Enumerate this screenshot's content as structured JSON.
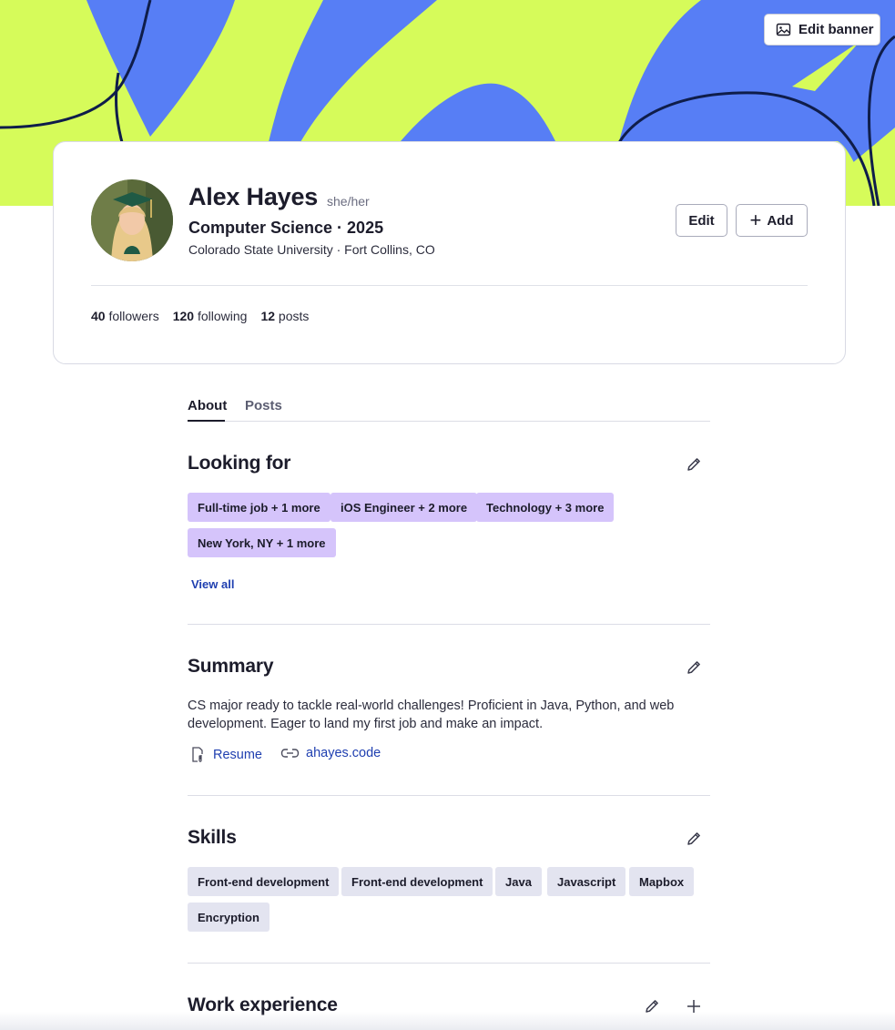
{
  "banner": {
    "edit_label": "Edit banner",
    "colors": {
      "lime": "#d6fb5a",
      "blue": "#577ef5",
      "navy": "#0f1d4a"
    }
  },
  "profile": {
    "name": "Alex Hayes",
    "pronouns": "she/her",
    "headline": "Computer Science · 2025",
    "location": "Colorado State University · Fort Collins, CO",
    "edit_label": "Edit",
    "add_label": "Add",
    "stats": [
      {
        "count": "40",
        "label": "followers"
      },
      {
        "count": "120",
        "label": "following"
      },
      {
        "count": "12",
        "label": "posts"
      }
    ]
  },
  "tabs": [
    {
      "label": "About",
      "active": true
    },
    {
      "label": "Posts",
      "active": false
    }
  ],
  "looking_for": {
    "title": "Looking for",
    "chips": [
      "Full-time job + 1 more",
      "iOS Engineer + 2 more",
      "Technology + 3 more",
      "New York, NY + 1 more"
    ],
    "view_all": "View all"
  },
  "summary": {
    "title": "Summary",
    "text": "CS major ready to tackle real-world challenges! Proficient in Java, Python, and web development. Eager to land my first job and make an impact.",
    "links": [
      {
        "label": "Resume",
        "icon": "paperclip-document-icon"
      },
      {
        "label": "ahayes.code",
        "icon": "link-icon"
      }
    ]
  },
  "skills": {
    "title": "Skills",
    "chips": [
      "Front-end development",
      "Front-end development",
      "Java",
      "Javascript",
      "Mapbox",
      "Encryption"
    ]
  },
  "work_experience": {
    "title": "Work experience"
  }
}
